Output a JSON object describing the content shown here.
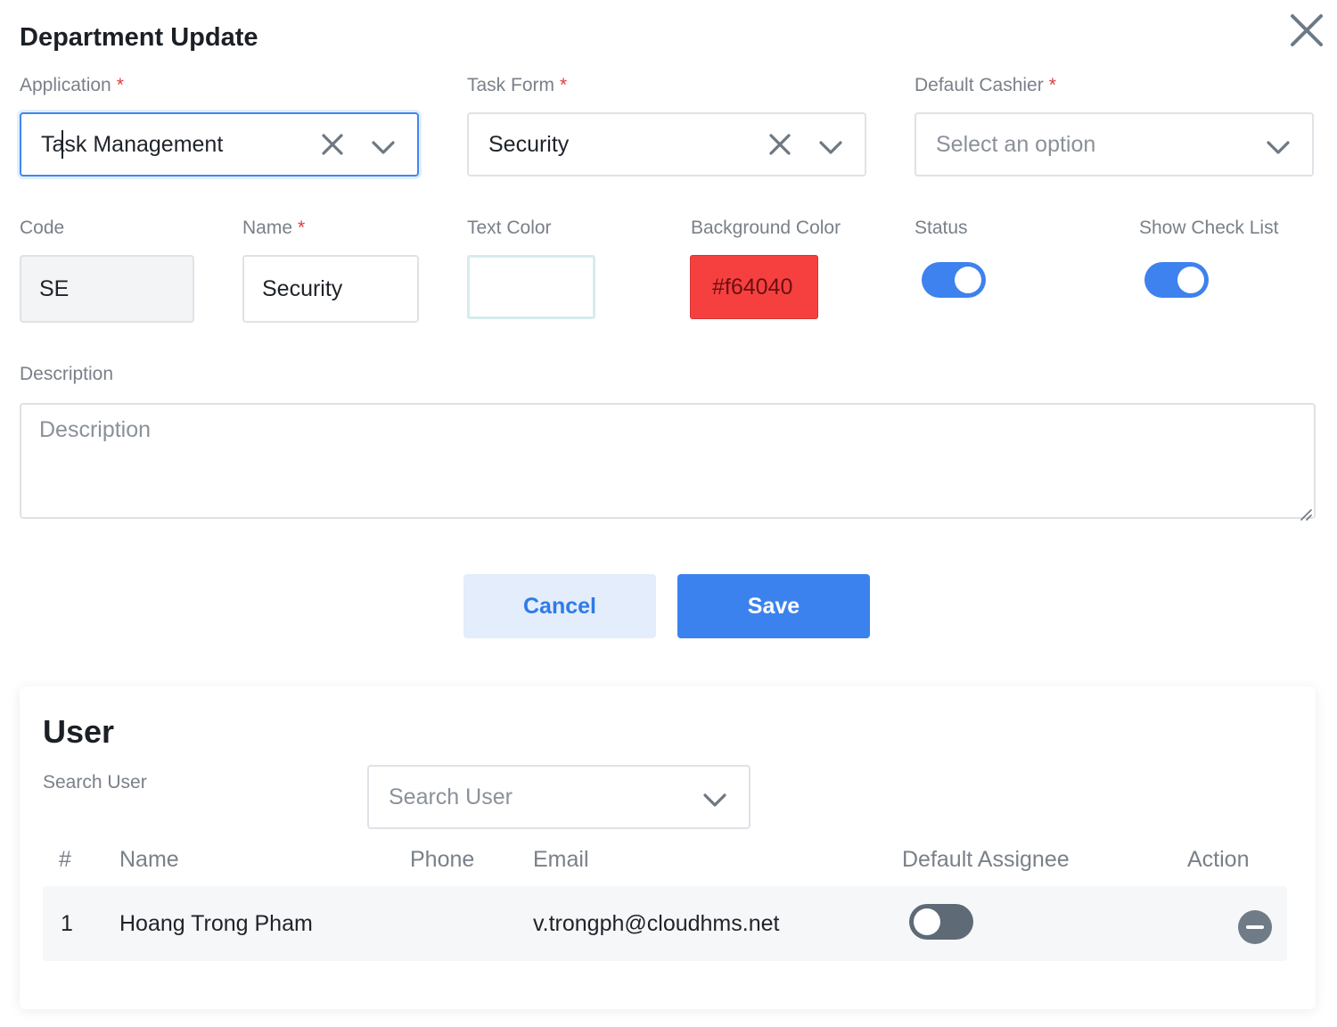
{
  "dialog": {
    "title": "Department Update"
  },
  "form": {
    "application": {
      "label": "Application",
      "value": "Task Management"
    },
    "task_form": {
      "label": "Task Form",
      "value": "Security"
    },
    "default_cashier": {
      "label": "Default Cashier",
      "placeholder": "Select an option"
    },
    "required_mark": "*",
    "code": {
      "label": "Code",
      "value": "SE"
    },
    "name": {
      "label": "Name",
      "value": "Security"
    },
    "text_color": {
      "label": "Text Color",
      "value": ""
    },
    "background_color": {
      "label": "Background Color",
      "value": "#f64040"
    },
    "status": {
      "label": "Status",
      "on": true
    },
    "show_check_list": {
      "label": "Show Check List",
      "on": true
    },
    "description": {
      "label": "Description",
      "placeholder": "Description"
    }
  },
  "actions": {
    "cancel_label": "Cancel",
    "save_label": "Save"
  },
  "users": {
    "title": "User",
    "search_label": "Search User",
    "search_placeholder": "Search User",
    "columns": {
      "index": "#",
      "name": "Name",
      "phone": "Phone",
      "email": "Email",
      "default_assignee": "Default Assignee",
      "action": "Action"
    },
    "rows": [
      {
        "index": "1",
        "name": "Hoang Trong Pham",
        "phone": "",
        "email": "v.trongph@cloudhms.net",
        "default_assignee": false
      }
    ]
  },
  "colors": {
    "primary": "#3b82ee",
    "background_color_swatch": "#f64040",
    "required": "#e03b3b"
  },
  "icons": {
    "close": "close-icon",
    "clear": "clear-x-icon",
    "dropdown": "chevron-down-icon",
    "remove": "minus-circle-icon"
  }
}
